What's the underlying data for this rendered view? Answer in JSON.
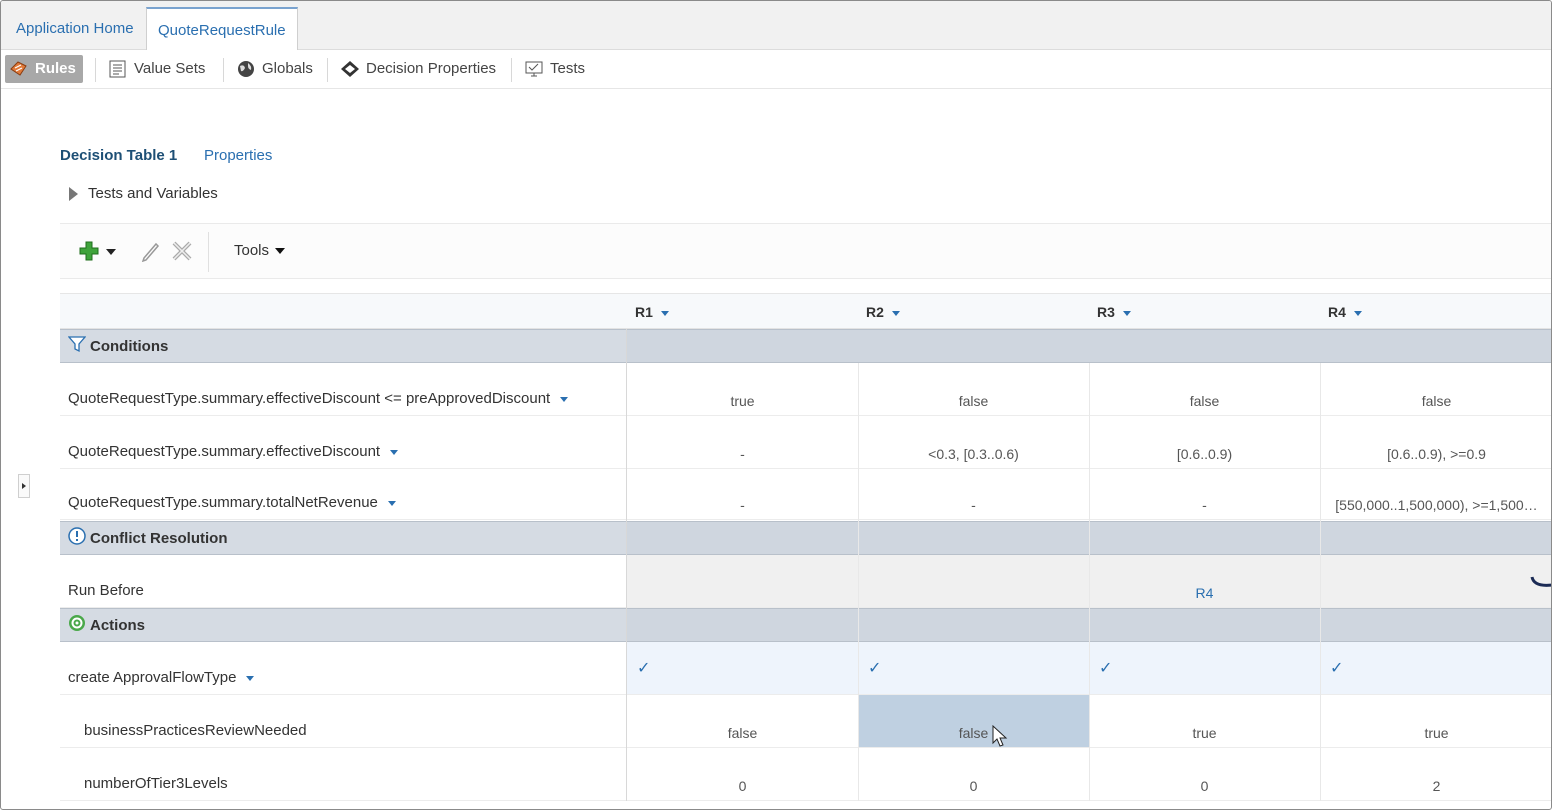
{
  "tabs": {
    "home": "Application Home",
    "active": "QuoteRequestRule"
  },
  "sections": {
    "rules": "Rules",
    "value_sets": "Value Sets",
    "globals": "Globals",
    "decision_properties": "Decision Properties",
    "tests": "Tests"
  },
  "decision_table": {
    "title": "Decision Table 1",
    "properties_link": "Properties",
    "tests_and_variables": "Tests and Variables",
    "tools_label": "Tools"
  },
  "columns": [
    "R1",
    "R2",
    "R3",
    "R4"
  ],
  "conditions": {
    "label": "Conditions",
    "rows": [
      {
        "label": "QuoteRequestType.summary.effectiveDiscount <= preApprovedDiscount",
        "values": [
          "true",
          "false",
          "false",
          "false"
        ]
      },
      {
        "label": "QuoteRequestType.summary.effectiveDiscount",
        "values": [
          "-",
          "<0.3, [0.3..0.6)",
          "[0.6..0.9)",
          "[0.6..0.9), >=0.9"
        ]
      },
      {
        "label": "QuoteRequestType.summary.totalNetRevenue",
        "values": [
          "-",
          "-",
          "-",
          "[550,000..1,500,000), >=1,500…"
        ]
      }
    ]
  },
  "conflict": {
    "label": "Conflict Resolution",
    "run_before_label": "Run Before",
    "run_before_values": [
      "",
      "",
      "R4",
      ""
    ]
  },
  "actions": {
    "label": "Actions",
    "action_label": "create ApprovalFlowType",
    "checks": [
      "✓",
      "✓",
      "✓",
      "✓"
    ],
    "params": [
      {
        "label": "businessPracticesReviewNeeded",
        "values": [
          "false",
          "false",
          "true",
          "true"
        ]
      },
      {
        "label": "numberOfTier3Levels",
        "values": [
          "0",
          "0",
          "0",
          "2"
        ]
      }
    ]
  },
  "colors": {
    "link": "#2a6fb0",
    "section_bg": "#d5dbe3",
    "selected_cell": "#bfd0e1"
  }
}
